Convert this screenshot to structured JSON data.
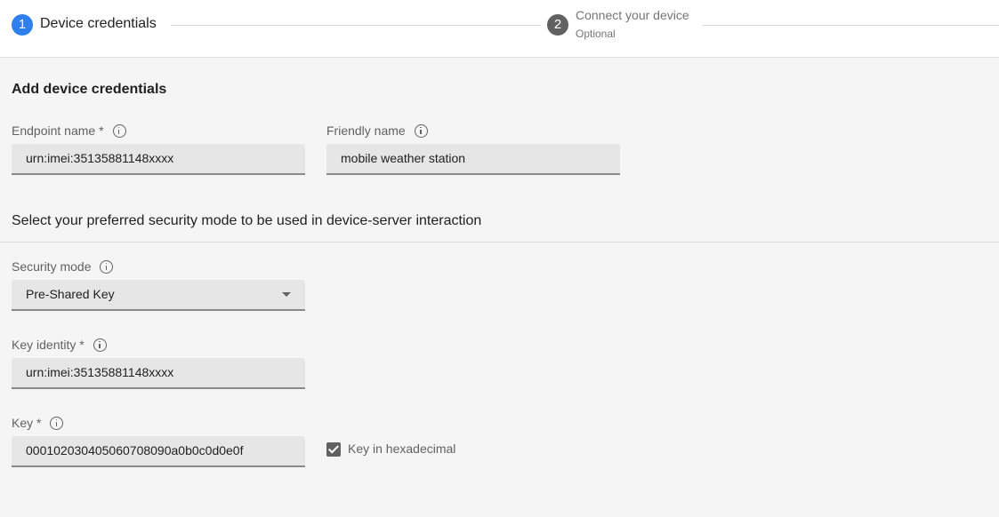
{
  "stepper": {
    "step1": {
      "number": "1",
      "label": "Device credentials"
    },
    "step2": {
      "number": "2",
      "label": "Connect your device",
      "sublabel": "Optional"
    }
  },
  "form": {
    "section_title": "Add device credentials",
    "endpoint_name": {
      "label": "Endpoint name *",
      "value": "urn:imei:35135881148xxxx"
    },
    "friendly_name": {
      "label": "Friendly name",
      "value": "mobile weather station"
    },
    "security_instruction": "Select your preferred security mode to be used in device-server interaction",
    "security_mode": {
      "label": "Security mode",
      "value": "Pre-Shared Key"
    },
    "key_identity": {
      "label": "Key identity *",
      "value": "urn:imei:35135881148xxxx"
    },
    "key": {
      "label": "Key *",
      "value": "000102030405060708090a0b0c0d0e0f"
    },
    "key_hex_checkbox": {
      "label": "Key in hexadecimal",
      "checked": true
    }
  },
  "colors": {
    "active_step": "#2f80ed",
    "inactive_step": "#616161",
    "input_bg": "#e6e6e6",
    "page_bg": "#f5f5f5"
  }
}
